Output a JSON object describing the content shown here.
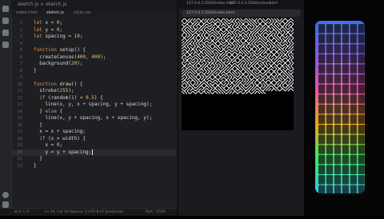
{
  "editor": {
    "breadcrumb": "sketch.js  >  sketch.js",
    "tabs": [
      "index.html",
      "sketch.js",
      "style.css"
    ],
    "status": {
      "left": "⊗ 0  ⚠ 0",
      "middle": "Ln 20, Col 29   Spaces: 2   UTF-8   LF   JavaScript",
      "right": "Port : 5500"
    }
  },
  "code": {
    "lines": [
      {
        "n": "1",
        "text": "let x = 0;"
      },
      {
        "n": "2",
        "text": "let y = 0;"
      },
      {
        "n": "3",
        "text": "let spacing = 10;"
      },
      {
        "n": "4",
        "text": ""
      },
      {
        "n": "5",
        "text": "function setup() {"
      },
      {
        "n": "6",
        "text": "  createCanvas(400, 400);"
      },
      {
        "n": "7",
        "text": "  background(20);"
      },
      {
        "n": "8",
        "text": "}"
      },
      {
        "n": "9",
        "text": ""
      },
      {
        "n": "10",
        "text": "function draw() {"
      },
      {
        "n": "11",
        "text": "  stroke(255);"
      },
      {
        "n": "12",
        "text": "  if (random(1) < 0.5) {"
      },
      {
        "n": "13",
        "text": "    line(x, y, x + spacing, y + spacing);"
      },
      {
        "n": "14",
        "text": "  } else {"
      },
      {
        "n": "15",
        "text": "    line(x, y + spacing, x + spacing, y);"
      },
      {
        "n": "16",
        "text": "  }"
      },
      {
        "n": "17",
        "text": "  x = x + spacing;"
      },
      {
        "n": "18",
        "text": "  if (x > width) {"
      },
      {
        "n": "19",
        "text": "    x = 0;"
      },
      {
        "n": "20",
        "text": "    y = y + spacing;"
      },
      {
        "n": "21",
        "text": "  }"
      },
      {
        "n": "22",
        "text": "}"
      }
    ],
    "current_line": 20
  },
  "browser": {
    "tabs": [
      "127.0.0.1:5500/index.html",
      "127.0.0.1:5500/index.html",
      "+"
    ],
    "url": "127.0.0.1:5500/index.html"
  },
  "sketch": {
    "background": "#000000",
    "stroke": "#ffffff",
    "columns": 40,
    "filled_rows": 27
  },
  "colors": {
    "editor_bg": "#1e1f22",
    "keyword": "#e38f58",
    "number": "#f1c06b",
    "text": "#d7d9dc"
  }
}
